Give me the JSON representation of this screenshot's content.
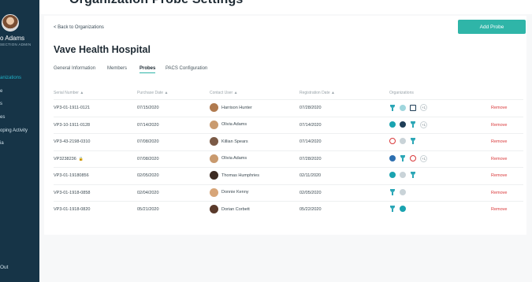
{
  "header": {
    "crop_title": "Organization Probe Settings"
  },
  "sidebar": {
    "user_name": "o Adams",
    "user_role": "SECTION ADMIN",
    "items": [
      {
        "label": "anizations",
        "active": true
      },
      {
        "label": "e",
        "active": false
      },
      {
        "label": "s",
        "active": false
      },
      {
        "label": "es",
        "active": false
      },
      {
        "label": "oping Activity",
        "active": false
      },
      {
        "label": "ia",
        "active": false
      }
    ],
    "logout": "Out"
  },
  "page": {
    "back": "< Back to Organizations",
    "title": "Vave Health Hospital",
    "add_button": "Add Probe",
    "tabs": [
      "General Information",
      "Members",
      "Probes",
      "PACS Configuration"
    ],
    "active_tab": "Probes"
  },
  "table": {
    "headers": [
      "Serial Number ▲",
      "Purchase Date ▲",
      "Contact User ▲",
      "Registration Date ▲",
      "Organizations"
    ],
    "remove_label": "Remove",
    "rows": [
      {
        "serial": "VP3-01-1911-0121",
        "purchase": "07/15/2020",
        "contact": "Harrison Hunter",
        "registration": "07/28/2020",
        "face": "#b07a4f",
        "orgs": [
          "trophy",
          "lt",
          "box"
        ],
        "more": "+1"
      },
      {
        "serial": "VP3-10-1911-0128",
        "purchase": "07/14/2020",
        "contact": "Olivia Adams",
        "registration": "07/14/2020",
        "face": "#c99a6e",
        "orgs": [
          "teal",
          "navy",
          "trophy"
        ],
        "more": "+1"
      },
      {
        "serial": "VP3-43-2198-0310",
        "purchase": "07/08/2020",
        "contact": "Killian Spears",
        "registration": "07/14/2020",
        "face": "#7b5a46",
        "orgs": [
          "red",
          "gray",
          "trophy"
        ],
        "more": ""
      },
      {
        "serial": "VP3238236",
        "purchase": "07/08/2020",
        "contact": "Olivia Adams",
        "registration": "07/28/2020",
        "face": "#c99a6e",
        "orgs": [
          "blue",
          "trophy",
          "red"
        ],
        "more": "+1",
        "lock": true
      },
      {
        "serial": "VP3-01-19180856",
        "purchase": "02/05/2020",
        "contact": "Thomas Humphries",
        "registration": "02/11/2020",
        "face": "#3d2b22",
        "orgs": [
          "teal",
          "gray",
          "trophy"
        ],
        "more": ""
      },
      {
        "serial": "VP3-01-1918-0858",
        "purchase": "02/04/2020",
        "contact": "Donnie Kenny",
        "registration": "02/05/2020",
        "face": "#d7a578",
        "orgs": [
          "trophy",
          "gray"
        ],
        "more": ""
      },
      {
        "serial": "VP3-01-1918-0820",
        "purchase": "05/21/2020",
        "contact": "Dorian Corbett",
        "registration": "05/22/2020",
        "face": "#5a3a2b",
        "orgs": [
          "trophy",
          "teal"
        ],
        "more": ""
      }
    ]
  },
  "colors": {
    "sidebar": "#163447",
    "accent": "#2fb5a8",
    "danger": "#d9383a"
  }
}
